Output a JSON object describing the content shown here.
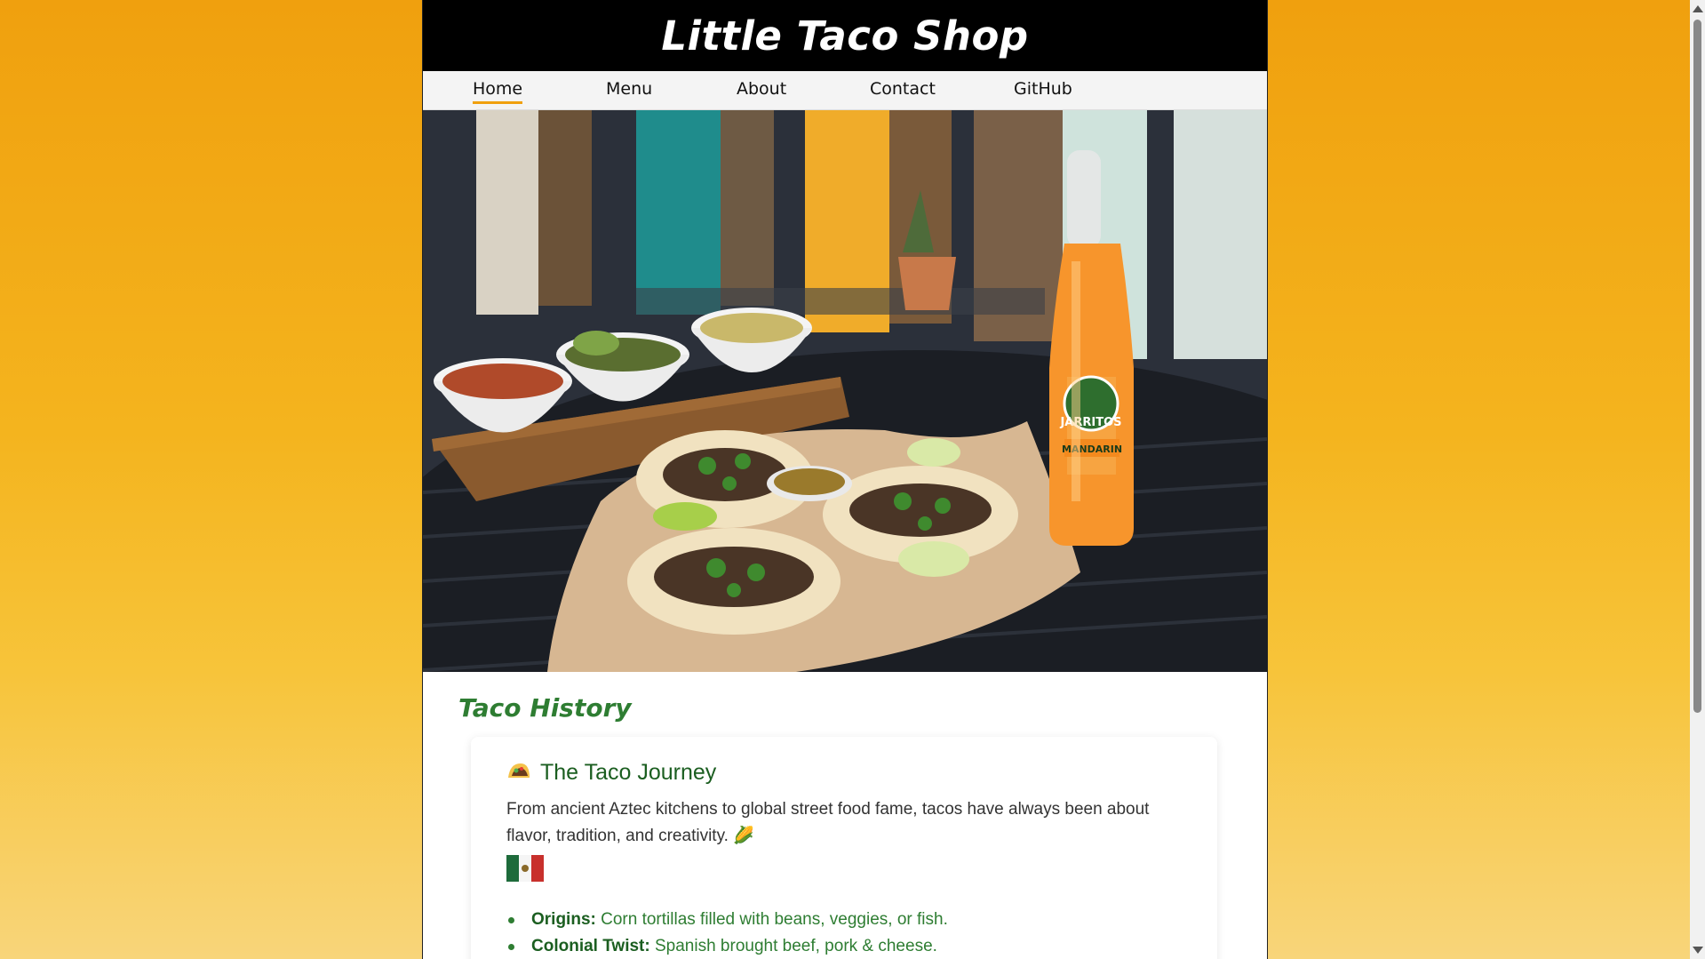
{
  "site": {
    "title": "Little Taco Shop"
  },
  "nav": {
    "items": [
      {
        "label": "Home",
        "active": true
      },
      {
        "label": "Menu",
        "active": false
      },
      {
        "label": "About",
        "active": false
      },
      {
        "label": "Contact",
        "active": false
      },
      {
        "label": "GitHub",
        "active": false
      }
    ]
  },
  "hero": {
    "bottle_brand": "JARRITOS",
    "bottle_flavor": "MANDARIN"
  },
  "section": {
    "title": "Taco History"
  },
  "card": {
    "icon": "taco-icon",
    "title": "The Taco Journey",
    "text": "From ancient Aztec kitchens to global street food fame, tacos have always been about flavor, tradition, and creativity. 🌽",
    "flag_icon": "mexico-flag-icon",
    "facts": [
      {
        "label": "Origins:",
        "text": " Corn tortillas filled with beans, veggies, or fish."
      },
      {
        "label": "Colonial Twist:",
        "text": " Spanish brought beef, pork & cheese."
      }
    ]
  },
  "colors": {
    "accent": "#f0a00e",
    "heading_green": "#2e7d32",
    "header_bg": "#000000"
  }
}
